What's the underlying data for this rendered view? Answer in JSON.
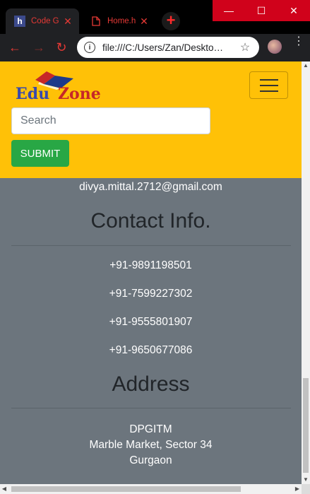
{
  "browser": {
    "tabs": [
      {
        "label": "Code G",
        "favicon": "h-favicon",
        "close": "✕"
      },
      {
        "label": "Home.h",
        "favicon": "page-icon",
        "close": "✕"
      }
    ],
    "new_tab": "+",
    "window_controls": {
      "minimize": "—",
      "maximize": "☐",
      "close": "✕"
    },
    "address": "file:///C:/Users/Zan/Deskto…",
    "info_glyph": "i",
    "favicon_letter": "h",
    "back": "←",
    "forward": "→",
    "reload": "↻",
    "star": "☆",
    "menu": "⋮"
  },
  "navbar": {
    "logo_text_1": "Edu",
    "logo_text_2": "Zone",
    "search_placeholder": "Search",
    "submit_label": "SUBMIT"
  },
  "content": {
    "email": "divya.mittal.2712@gmail.com",
    "contact_heading": "Contact Info.",
    "phones": [
      "+91-9891198501",
      "+91-7599227302",
      "+91-9555801907",
      "+91-9650677086"
    ],
    "address_heading": "Address",
    "address_lines": [
      "DPGITM",
      "Marble Market, Sector 34",
      "Gurgaon"
    ]
  },
  "scrollbar": {
    "up": "▲",
    "down": "▼",
    "left": "◀",
    "right": "▶"
  },
  "colors": {
    "navbar_bg": "#ffc107",
    "content_bg": "#6c757d",
    "submit_bg": "#28a745",
    "accent_red": "#e53935"
  }
}
